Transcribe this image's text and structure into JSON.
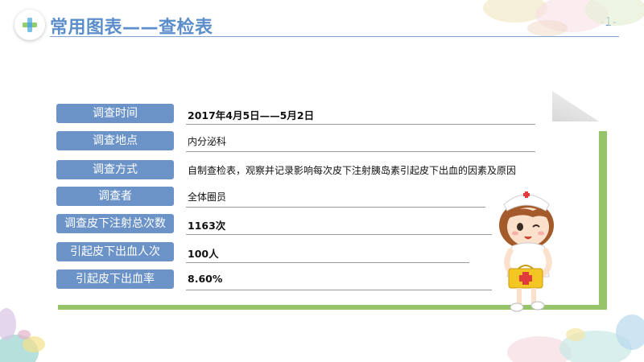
{
  "header": {
    "title": "常用图表——查检表",
    "page_number": "-1-",
    "logo_icon": "medical-cross-icon"
  },
  "table": {
    "rows": [
      {
        "label": "调查时间",
        "value": "2017年4月5日——5月2日"
      },
      {
        "label": "调查地点",
        "value": "内分泌科"
      },
      {
        "label": "调查方式",
        "value": "自制查检表，观察并记录影响每次皮下注射胰岛素引起皮下出血的因素及原因"
      },
      {
        "label": "调查者",
        "value": "全体圈员"
      },
      {
        "label": "调查皮下注射总次数",
        "value": "1163次"
      },
      {
        "label": "引起皮下出血人次",
        "value": "100人"
      },
      {
        "label": "引起皮下出血率",
        "value": "8.60%"
      }
    ]
  },
  "colors": {
    "accent_blue": "#5b8ecb",
    "pill_blue": "#6b93c7",
    "green_frame": "#95c46b"
  },
  "illustration": "nurse-cartoon"
}
